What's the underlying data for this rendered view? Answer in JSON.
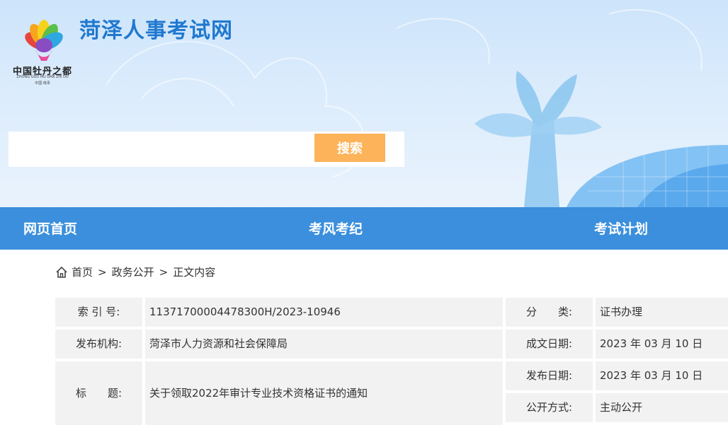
{
  "header": {
    "site_title": "菏泽人事考试网",
    "logo": {
      "text": "中国牡丹之都",
      "subtitle": "ZHONG GUO MU DAN ZHI DU",
      "location": "中国·菏泽",
      "petal_colors": [
        "#e8453c",
        "#f7a51c",
        "#f7d21c",
        "#5cbf4a",
        "#2fa7e0",
        "#8a4cc2",
        "#e84c9b"
      ]
    }
  },
  "search": {
    "placeholder": "",
    "button_label": "搜索",
    "button_color": "#fcb35a"
  },
  "nav": {
    "background": "#3b8fdc",
    "items": [
      {
        "label": "网页首页"
      },
      {
        "label": "考风考纪"
      },
      {
        "label": "考试计划"
      }
    ]
  },
  "breadcrumb": {
    "icon": "home-icon",
    "items": [
      "首页",
      "政务公开",
      "正文内容"
    ],
    "separator": ">"
  },
  "info_table": {
    "index_label": "索 引 号:",
    "index_value": "11371700004478300H/2023-10946",
    "category_label": "分　　类:",
    "category_value": "证书办理",
    "org_label": "发布机构:",
    "org_value": "菏泽市人力资源和社会保障局",
    "written_label": "成文日期:",
    "written_value": "2023 年 03 月 10 日",
    "title_label": "标　　题:",
    "title_value": "关于领取2022年审计专业技术资格证书的通知",
    "published_label": "发布日期:",
    "published_value": "2023 年 03 月 10 日",
    "disclosure_label": "公开方式:",
    "disclosure_value": "主动公开"
  }
}
